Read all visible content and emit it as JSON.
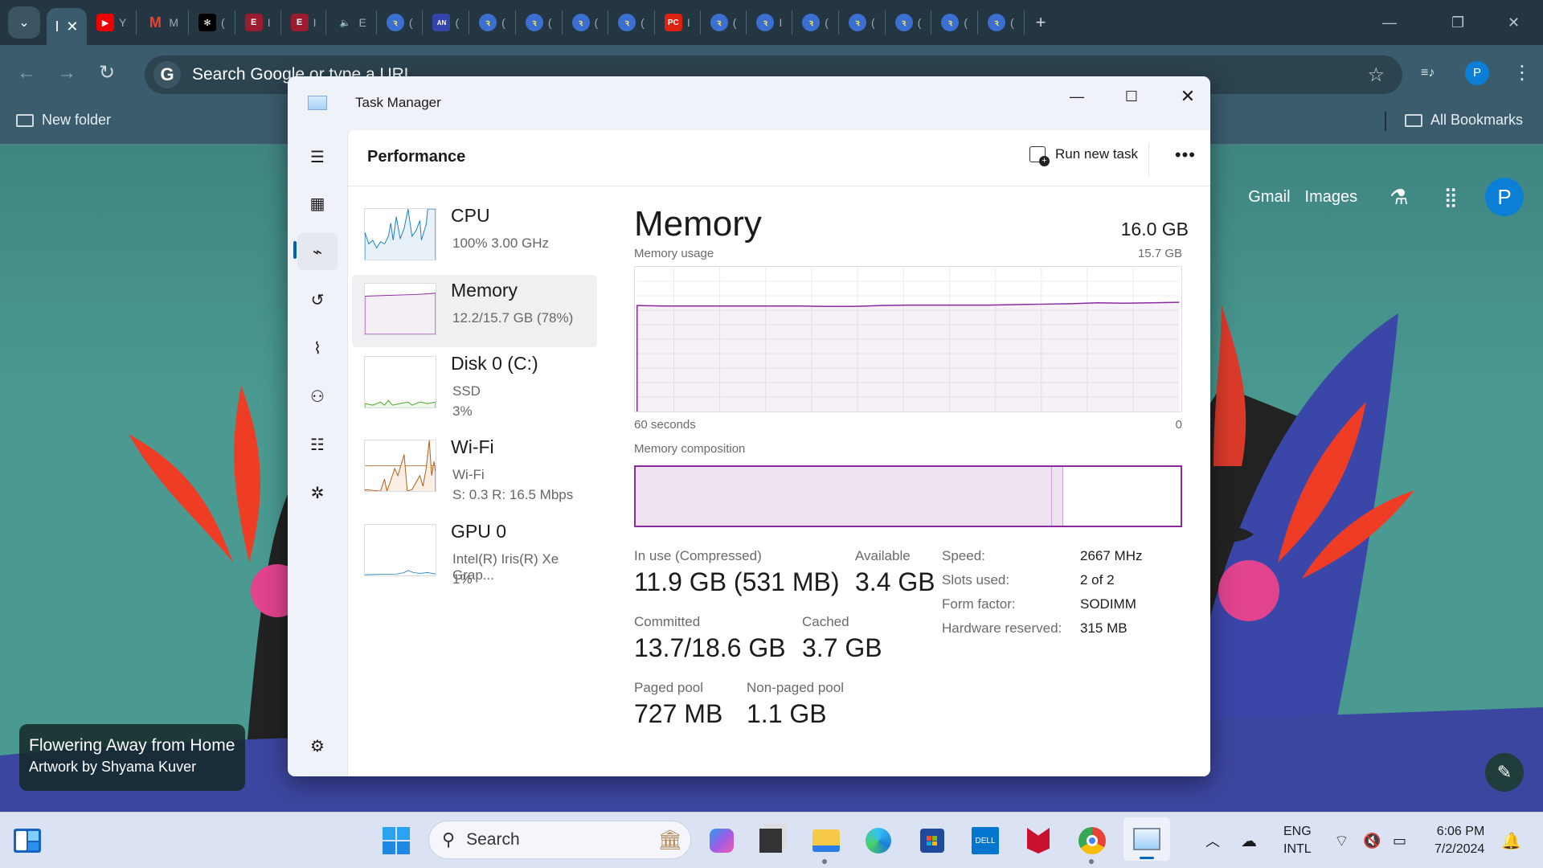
{
  "browser": {
    "tabs": [
      {
        "icon": "youtube-icon",
        "label": "Y"
      },
      {
        "icon": "gmail-icon",
        "label": "M"
      },
      {
        "icon": "chatgpt-icon",
        "label": "("
      },
      {
        "icon": "e-app-icon",
        "label": "I"
      },
      {
        "icon": "e-app-icon",
        "label": "I"
      },
      {
        "icon": "audio-icon",
        "label": "E"
      },
      {
        "icon": "circle-app-icon",
        "label": "("
      },
      {
        "icon": "anphat-icon",
        "label": "("
      },
      {
        "icon": "circle-app-icon",
        "label": "("
      },
      {
        "icon": "circle-app-icon",
        "label": "("
      },
      {
        "icon": "circle-app-icon",
        "label": "("
      },
      {
        "icon": "circle-app-icon",
        "label": "("
      },
      {
        "icon": "pcgamer-icon",
        "label": "I"
      },
      {
        "icon": "circle-app-icon",
        "label": "("
      },
      {
        "icon": "circle-app-icon",
        "label": "I"
      },
      {
        "icon": "circle-app-icon",
        "label": "("
      },
      {
        "icon": "circle-app-icon",
        "label": "("
      },
      {
        "icon": "circle-app-icon",
        "label": "("
      },
      {
        "icon": "circle-app-icon",
        "label": "("
      },
      {
        "icon": "circle-app-icon",
        "label": "("
      }
    ],
    "active_tab_label": "I",
    "omnibox_placeholder": "Search Google or type a URL",
    "profile_initial": "P",
    "bookmarks": {
      "left": "New folder",
      "right": "All Bookmarks"
    }
  },
  "ntp": {
    "links": [
      "Gmail",
      "Images"
    ],
    "profile_initial": "P",
    "credit_title": "Flowering Away from Home",
    "credit_artist": "Artwork by Shyama Kuver"
  },
  "task_manager": {
    "title": "Task Manager",
    "page_title": "Performance",
    "run_new_task": "Run new task",
    "devices": [
      {
        "name": "CPU",
        "line1": "100%  3.00 GHz",
        "line2": "",
        "color": "#1a7fc1"
      },
      {
        "name": "Memory",
        "line1": "12.2/15.7 GB (78%)",
        "line2": "",
        "color": "#8b2a9f"
      },
      {
        "name": "Disk 0 (C:)",
        "line1": "SSD",
        "line2": "3%",
        "color": "#4ca62a"
      },
      {
        "name": "Wi-Fi",
        "line1": "Wi-Fi",
        "line2": "S: 0.3  R: 16.5 Mbps",
        "color": "#b35a16"
      },
      {
        "name": "GPU 0",
        "line1": "Intel(R) Iris(R) Xe Grap...",
        "line2": "1%",
        "color": "#1a7fc1"
      }
    ],
    "memory": {
      "heading": "Memory",
      "total": "16.0 GB",
      "usage_label": "Memory usage",
      "usage_max": "15.7 GB",
      "axis_left": "60 seconds",
      "axis_right": "0",
      "composition_label": "Memory composition",
      "composition": {
        "in_use_fraction": 0.762,
        "modified_fraction": 0.022,
        "standby_fraction": 0.216
      },
      "stats": {
        "in_use_label": "In use (Compressed)",
        "in_use": "11.9 GB (531 MB)",
        "available_label": "Available",
        "available": "3.4 GB",
        "committed_label": "Committed",
        "committed": "13.7/18.6 GB",
        "cached_label": "Cached",
        "cached": "3.7 GB",
        "paged_label": "Paged pool",
        "paged": "727 MB",
        "nonpaged_label": "Non-paged pool",
        "nonpaged": "1.1 GB"
      },
      "specs": [
        {
          "k": "Speed:",
          "v": "2667 MHz"
        },
        {
          "k": "Slots used:",
          "v": "2 of 2"
        },
        {
          "k": "Form factor:",
          "v": "SODIMM"
        },
        {
          "k": "Hardware reserved:",
          "v": "315 MB"
        }
      ]
    }
  },
  "chart_data": {
    "type": "area",
    "title": "Memory usage",
    "xlabel": "60 seconds",
    "ylabel": "",
    "ylim": [
      0,
      15.7
    ],
    "x": [
      60,
      57,
      54,
      51,
      48,
      45,
      42,
      39,
      36,
      33,
      30,
      27,
      24,
      21,
      18,
      15,
      12,
      9,
      6,
      3,
      0
    ],
    "series": [
      {
        "name": "Memory usage (GB)",
        "values": [
          11.5,
          11.45,
          11.45,
          11.45,
          11.45,
          11.45,
          11.45,
          11.4,
          11.4,
          11.5,
          11.55,
          11.55,
          11.55,
          11.55,
          11.6,
          11.65,
          11.7,
          11.8,
          11.75,
          11.8,
          11.85
        ]
      }
    ],
    "grid": true
  },
  "taskbar": {
    "search_placeholder": "Search",
    "lang_line1": "ENG",
    "lang_line2": "INTL",
    "time": "6:06 PM",
    "date": "7/2/2024"
  }
}
